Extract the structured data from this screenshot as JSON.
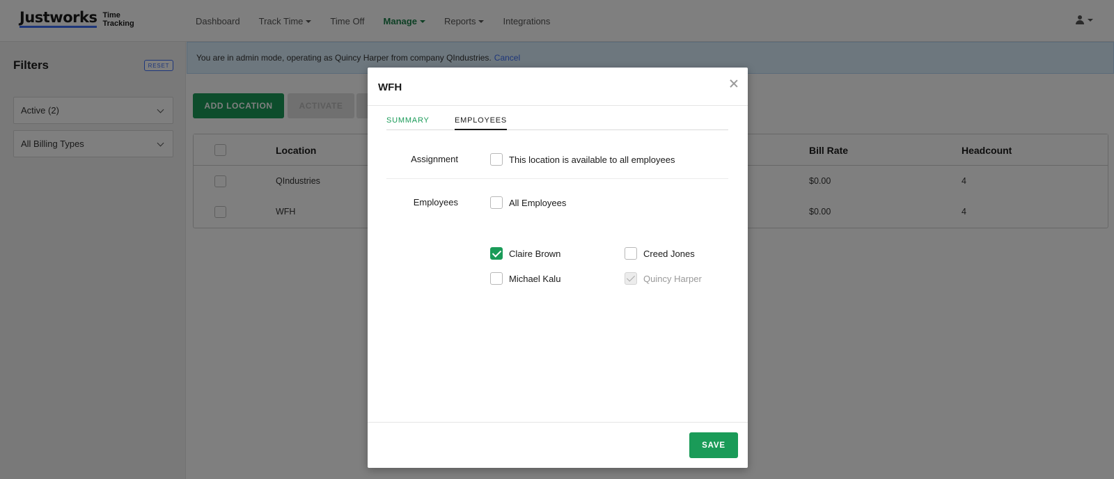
{
  "brand": {
    "name": "Justworks",
    "sub_line1": "Time",
    "sub_line2": "Tracking"
  },
  "nav": {
    "items": [
      {
        "label": "Dashboard",
        "caret": false,
        "active": false
      },
      {
        "label": "Track Time",
        "caret": true,
        "active": false
      },
      {
        "label": "Time Off",
        "caret": false,
        "active": false
      },
      {
        "label": "Manage",
        "caret": true,
        "active": true
      },
      {
        "label": "Reports",
        "caret": true,
        "active": false
      },
      {
        "label": "Integrations",
        "caret": false,
        "active": false
      }
    ],
    "user_icon": "user-icon"
  },
  "sidebar": {
    "title": "Filters",
    "reset_label": "RESET",
    "filters": [
      {
        "value": "Active (2)"
      },
      {
        "value": "All Billing Types"
      }
    ]
  },
  "admin_bar": {
    "message": "You are in admin mode, operating as Quincy Harper from company QIndustries.",
    "cancel_label": "Cancel"
  },
  "toolbar": {
    "add_location_label": "ADD LOCATION",
    "activate_label": "ACTIVATE"
  },
  "table": {
    "headers": {
      "location": "Location",
      "bill_rate": "Bill Rate",
      "headcount": "Headcount"
    },
    "rows": [
      {
        "location": "QIndustries",
        "bill_rate": "$0.00",
        "headcount": "4"
      },
      {
        "location": "WFH",
        "bill_rate": "$0.00",
        "headcount": "4"
      }
    ]
  },
  "modal": {
    "title": "WFH",
    "tabs": [
      {
        "label": "SUMMARY"
      },
      {
        "label": "EMPLOYEES"
      }
    ],
    "active_tab": "EMPLOYEES",
    "assignment_label": "Assignment",
    "assignment_option": "This location is available to all employees",
    "assignment_checked": false,
    "employees_label": "Employees",
    "all_employees_label": "All Employees",
    "all_employees_checked": false,
    "employees": [
      {
        "name": "Claire Brown",
        "checked": true,
        "disabled": false
      },
      {
        "name": "Creed Jones",
        "checked": false,
        "disabled": false
      },
      {
        "name": "Michael Kalu",
        "checked": false,
        "disabled": false
      },
      {
        "name": "Quincy Harper",
        "checked": true,
        "disabled": true
      }
    ],
    "save_label": "SAVE"
  },
  "colors": {
    "accent_green": "#1a9b58",
    "link_blue": "#3a6cf4",
    "admin_bar_bg": "#dbeefc"
  }
}
